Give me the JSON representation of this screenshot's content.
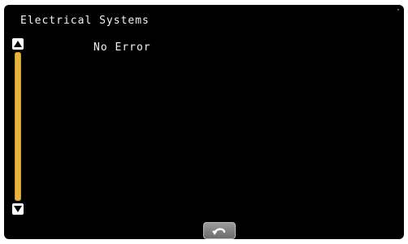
{
  "header": {
    "title": "Electrical Systems",
    "corner_mark": "·"
  },
  "content": {
    "status_text": "No Error"
  },
  "scrollbar": {
    "up_icon": "arrow-up-icon",
    "down_icon": "arrow-down-icon",
    "track_color": "#e8b53c"
  },
  "footer": {
    "back_icon": "back-arrow-icon"
  },
  "colors": {
    "background": "#000000",
    "text": "#f2f2f2",
    "accent": "#e8b53c"
  }
}
